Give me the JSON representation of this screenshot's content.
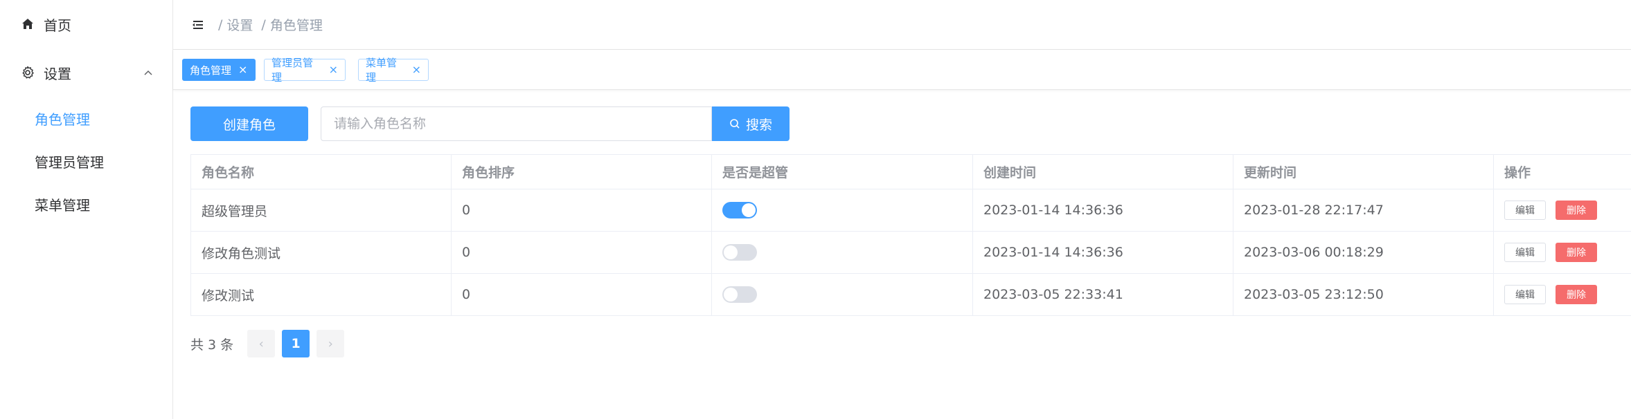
{
  "sidebar": {
    "home_label": "首页",
    "settings_label": "设置",
    "items": [
      {
        "label": "角色管理",
        "active": true
      },
      {
        "label": "管理员管理",
        "active": false
      },
      {
        "label": "菜单管理",
        "active": false
      }
    ]
  },
  "header": {
    "breadcrumb": [
      {
        "sep": "/",
        "label": "设置"
      },
      {
        "sep": "/",
        "label": "角色管理"
      }
    ]
  },
  "tags": [
    {
      "label": "角色管理",
      "close": "×",
      "active": true
    },
    {
      "label": "管理员管理",
      "close": "×",
      "active": false
    },
    {
      "label": "菜单管理",
      "close": "×",
      "active": false
    }
  ],
  "toolbar": {
    "create_label": "创建角色",
    "search_placeholder": "请输入角色名称",
    "search_value": "",
    "search_label": "搜索"
  },
  "table": {
    "columns": [
      "角色名称",
      "角色排序",
      "是否是超管",
      "创建时间",
      "更新时间",
      "操作"
    ],
    "rows": [
      {
        "name": "超级管理员",
        "sort": "0",
        "is_super": true,
        "created": "2023-01-14 14:36:36",
        "updated": "2023-01-28 22:17:47",
        "edit": "编辑",
        "delete": "删除"
      },
      {
        "name": "修改角色测试",
        "sort": "0",
        "is_super": false,
        "created": "2023-01-14 14:36:36",
        "updated": "2023-03-06 00:18:29",
        "edit": "编辑",
        "delete": "删除"
      },
      {
        "name": "修改测试",
        "sort": "0",
        "is_super": false,
        "created": "2023-03-05 22:33:41",
        "updated": "2023-03-05 23:12:50",
        "edit": "编辑",
        "delete": "删除"
      }
    ]
  },
  "pagination": {
    "total_text": "共 3 条",
    "prev": "‹",
    "current": "1",
    "next": "›"
  },
  "colors": {
    "primary": "#409eff",
    "danger": "#f56c6c",
    "switch_off": "#dcdfe6"
  }
}
